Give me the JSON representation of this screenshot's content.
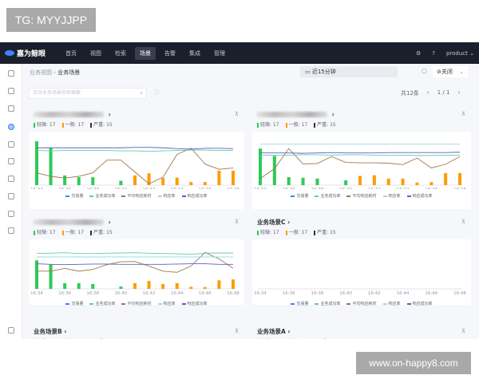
{
  "watermarks": {
    "top_left": "TG: MYYJJPP",
    "bottom_right": "www.on-happy8.com"
  },
  "header": {
    "logo": "嘉为鲸眼",
    "nav": [
      "首页",
      "视图",
      "检索",
      "场景",
      "告警",
      "集成",
      "管理"
    ],
    "active_nav": "场景",
    "user": "product"
  },
  "breadcrumb": {
    "parent": "业务视图",
    "current": "业务场景"
  },
  "toolbar": {
    "time_range": "近15分钟",
    "auto_refresh": "关闭",
    "search_placeholder": "支持业务场景名称搜索",
    "total": "共12条",
    "page": "1 / 1"
  },
  "colors": {
    "minor": "#2dcb56",
    "normal": "#ff9c01",
    "critical": "#313238",
    "brown": "#a0784a",
    "purple": "#5b5fc7",
    "teal": "#5fcfa8",
    "lightteal": "#9ed8e6",
    "blue": "#3a84ff"
  },
  "legend": [
    "交易量",
    "业务成功率",
    "平均响应耗时",
    "响应率",
    "响应成功率"
  ],
  "x_ticks": [
    "16:34",
    "16:36",
    "16:38",
    "16:40",
    "16:42",
    "16:44",
    "16:46",
    "16:48"
  ],
  "cards": [
    {
      "title": "",
      "stats": {
        "minor": "轻微: 17",
        "normal": "一般: 17",
        "critical": "严重: 15"
      }
    },
    {
      "title": "",
      "stats": {
        "minor": "轻微: 17",
        "normal": "一般: 17",
        "critical": "严重: 15"
      }
    },
    {
      "title": "",
      "stats": {
        "minor": "轻微: 17",
        "normal": "一般: 17",
        "critical": "严重: 15"
      }
    },
    {
      "title": "业务场景C",
      "stats": {
        "minor": "轻微: 17",
        "normal": "一般: 17",
        "critical": "严重: 15"
      }
    },
    {
      "title": "业务场景B",
      "stats": {
        "minor": "轻微: 17",
        "normal": "一般: 17",
        "critical": "严重: 15"
      }
    },
    {
      "title": "业务场景A",
      "stats": {
        "minor": "轻微: 17",
        "normal": "一般: 17",
        "critical": "严重: 15"
      }
    }
  ],
  "chart_data": [
    {
      "type": "bar+line",
      "x": [
        "16:34",
        "16:35",
        "16:36",
        "16:37",
        "16:38",
        "16:39",
        "16:40",
        "16:41",
        "16:42",
        "16:43",
        "16:44",
        "16:45",
        "16:46",
        "16:47",
        "16:48"
      ],
      "ylim": [
        0,
        100
      ],
      "bars": [
        100,
        85,
        22,
        18,
        18,
        0,
        10,
        22,
        27,
        16,
        17,
        7,
        7,
        33,
        33
      ],
      "series": [
        {
          "name": "平均响应耗时",
          "values": [
            28,
            20,
            16,
            20,
            28,
            57,
            57,
            30,
            3,
            18,
            70,
            84,
            48,
            36,
            39
          ]
        },
        {
          "name": "响应成功率",
          "values": [
            85,
            85,
            85,
            85,
            85,
            85,
            85,
            86,
            86,
            85,
            83,
            82,
            84,
            84,
            83
          ]
        },
        {
          "name": "业务成功率",
          "values": [
            79,
            78,
            79,
            79,
            79,
            79,
            78,
            78,
            77,
            78,
            79,
            80,
            80,
            79,
            79
          ]
        }
      ]
    },
    {
      "type": "bar+line",
      "x": [
        "16:34",
        "16:35",
        "16:36",
        "16:37",
        "16:38",
        "16:39",
        "16:40",
        "16:41",
        "16:42",
        "16:43",
        "16:44",
        "16:45",
        "16:46",
        "16:47",
        "16:48"
      ],
      "ylim": [
        0,
        120
      ],
      "bars": [
        100,
        80,
        22,
        20,
        18,
        0,
        13,
        25,
        27,
        18,
        18,
        7,
        8,
        33,
        33
      ],
      "series": [
        {
          "name": "平均响应耗时",
          "values": [
            18,
            45,
            100,
            58,
            59,
            78,
            62,
            61,
            61,
            60,
            56,
            74,
            47,
            57,
            78
          ]
        },
        {
          "name": "响应成功率",
          "values": [
            88,
            88,
            88,
            87,
            88,
            89,
            88,
            88,
            88,
            89,
            89,
            89,
            89,
            89,
            90
          ]
        },
        {
          "name": "业务成功率",
          "values": [
            82,
            82,
            82,
            83,
            83,
            82,
            83,
            83,
            82,
            82,
            82,
            81,
            81,
            82,
            82
          ]
        },
        {
          "name": "响应率",
          "values": [
            112,
            112,
            112,
            112,
            112,
            112,
            112,
            112,
            112,
            112,
            112,
            112,
            112,
            112,
            112
          ]
        }
      ]
    },
    {
      "type": "bar+line",
      "x": [
        "16:34",
        "16:35",
        "16:36",
        "16:37",
        "16:38",
        "16:39",
        "16:40",
        "16:41",
        "16:42",
        "16:43",
        "16:44",
        "16:45",
        "16:46",
        "16:47",
        "16:48"
      ],
      "ylim": [
        0,
        140
      ],
      "bars": [
        100,
        85,
        20,
        20,
        17,
        0,
        8,
        20,
        28,
        17,
        20,
        7,
        6,
        30,
        33
      ],
      "series": [
        {
          "name": "平均响应耗时",
          "values": [
            62,
            62,
            72,
            62,
            68,
            85,
            95,
            96,
            80,
            62,
            58,
            80,
            128,
            105,
            72
          ]
        },
        {
          "name": "业务成功率",
          "values": [
            124,
            125,
            127,
            124,
            124,
            125,
            126,
            127,
            125,
            124,
            123,
            121,
            125,
            126,
            126
          ]
        },
        {
          "name": "响应率",
          "values": [
            112,
            112,
            112,
            112,
            112,
            112,
            112,
            112,
            112,
            112,
            112,
            112,
            112,
            112,
            112
          ]
        },
        {
          "name": "响应成功率",
          "values": [
            88,
            86,
            85,
            86,
            87,
            87,
            86,
            86,
            86,
            86,
            87,
            88,
            88,
            86,
            86
          ]
        }
      ]
    },
    {
      "type": "line",
      "x": [
        "16:34",
        "16:36",
        "16:38",
        "16:40",
        "16:42",
        "16:44",
        "16:46",
        "16:48"
      ],
      "series": []
    }
  ]
}
